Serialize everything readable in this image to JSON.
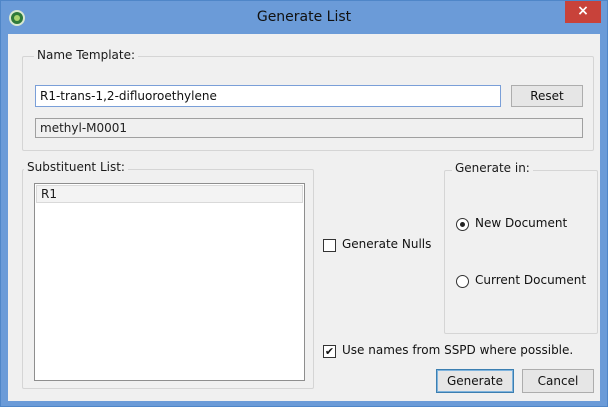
{
  "window": {
    "title": "Generate List",
    "close_label": "×",
    "accent": "#6b9bd8",
    "close_color": "#c8423a"
  },
  "name_template": {
    "legend": "Name Template:",
    "input_value": "R1-trans-1,2-difluoroethylene",
    "reset_label": "Reset",
    "preview_value": "methyl-M0001"
  },
  "substituent_list": {
    "legend": "Substituent List:",
    "items": [
      "R1"
    ]
  },
  "options": {
    "generate_nulls_label": "Generate Nulls",
    "generate_nulls_checked": false,
    "use_names_label": "Use names from SSPD where possible.",
    "use_names_checked": true,
    "checkmark": "✔"
  },
  "generate_in": {
    "legend": "Generate in:",
    "new_document_label": "New Document",
    "current_document_label": "Current Document",
    "selected": "New Document"
  },
  "buttons": {
    "generate_label": "Generate",
    "cancel_label": "Cancel"
  }
}
